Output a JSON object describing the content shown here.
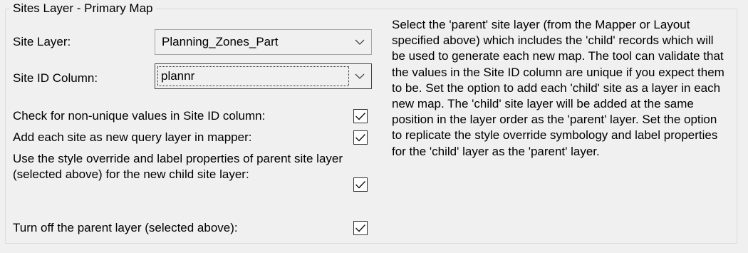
{
  "groupbox": {
    "title": "Sites Layer - Primary Map"
  },
  "site_layer": {
    "label": "Site Layer:",
    "value": "Planning_Zones_Part"
  },
  "site_id": {
    "label": "Site ID Column:",
    "value": "plannr"
  },
  "options": [
    {
      "label": "Check for non-unique values in Site ID column:",
      "checked": true
    },
    {
      "label": "Add each site as new query layer in mapper:",
      "checked": true
    },
    {
      "label": "Use the style override and label properties of parent site layer (selected above) for the new child site layer:",
      "checked": true
    },
    {
      "label": "Turn off the parent layer (selected above):",
      "checked": true
    }
  ],
  "help_text": "Select the 'parent' site layer (from the Mapper or Layout specified above) which includes the 'child' records which will be used to generate each new map. The tool can validate that the values in the Site ID column are unique if you expect them to be. Set the option to add each 'child' site as a layer in each new map. The 'child' site layer will be added at the same  position in the layer order as the 'parent' layer. Set the option to replicate the style override symbology and label properties for the 'child' layer as the 'parent' layer."
}
